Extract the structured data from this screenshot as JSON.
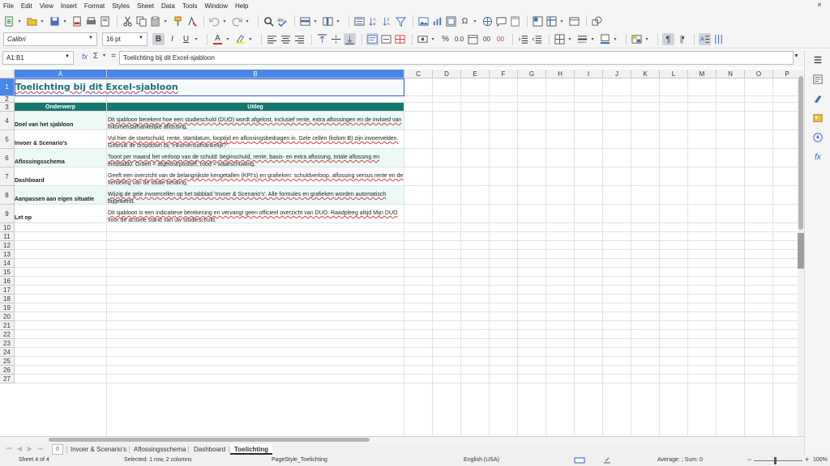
{
  "menubar": {
    "items": [
      "File",
      "Edit",
      "View",
      "Insert",
      "Format",
      "Styles",
      "Sheet",
      "Data",
      "Tools",
      "Window",
      "Help"
    ],
    "close_glyph": "×"
  },
  "toolbar": {
    "font_name": "Calibri",
    "font_size": "16 pt",
    "bold": "B",
    "italic": "I",
    "underline": "U",
    "font_color_letter": "A",
    "percent": "%",
    "decimal": "0.0",
    "remove_decimal": "00",
    "strike_decimal": "00",
    "currency_symbol": "$",
    "color_font": "#d32f2f",
    "color_highlight": "#ffeb3b",
    "color_border": "#1565c0"
  },
  "formulabar": {
    "name_box": "A1:B1",
    "content": "Toelichting bij dit Excel-sjabloon",
    "fx": "fx",
    "sigma": "Σ",
    "equals": "="
  },
  "grid": {
    "columns": [
      "A",
      "B",
      "C",
      "D",
      "E",
      "F",
      "G",
      "H",
      "I",
      "J",
      "K",
      "L",
      "M",
      "N",
      "O",
      "P"
    ],
    "rows": [
      "1",
      "2",
      "3",
      "4",
      "5",
      "6",
      "7",
      "8",
      "9",
      "10",
      "11",
      "12",
      "13",
      "14",
      "15",
      "16",
      "17",
      "18",
      "19",
      "20",
      "21",
      "22",
      "23",
      "24",
      "25",
      "26",
      "27"
    ],
    "title": "Toelichting bij dit Excel-sjabloon",
    "header_topic": "Onderwerp",
    "header_desc": "Uitleg",
    "header_color": "#17786f",
    "band_color": "#ebf9f7",
    "entries": [
      {
        "topic": "Doel van het sjabloon",
        "desc": "Dit sjabloon berekent hoe een studieschuld (DUO) wordt afgelost, inclusief rente, extra aflossingen en de invloed van inkomensafhankelijke aflossing."
      },
      {
        "topic": "Invoer & Scenario's",
        "desc": "Vul hier de startschuld, rente, startdatum, looptijd en aflossingsbedragen in. Gele cellen (kolom B) zijn invoervelden. Gebruik de dropdown bij 'Inkomensafhankelijk?'."
      },
      {
        "topic": "Aflossingsschema",
        "desc": "Toont per maand het verloop van de schuld: beginschuld, rente, basis- en extra aflossing, totale aflossing en eindsaldo. Groen = afgelost/positief, rood = waarschuwing."
      },
      {
        "topic": "Dashboard",
        "desc": "Geeft een overzicht van de belangrijkste kengetallen (KPI's) en grafieken: schuldverloop, aflossing versus rente en de verdeling van de totale betaling."
      },
      {
        "topic": "Aanpassen aan eigen situatie",
        "desc": "Wijzig de gele invoercellen op het tabblad 'Invoer & Scenario's'. Alle formules en grafieken worden automatisch bijgewerkt."
      },
      {
        "topic": "Let op",
        "desc": "Dit sjabloon is een indicatieve berekening en vervangt geen officieel overzicht van DUO. Raadpleeg altijd Mijn DUO voor de actuele stand van uw studieschuld."
      }
    ]
  },
  "tabs": {
    "add_label": "0",
    "sheets": [
      "Invoer & Scenario's",
      "Aflossingsschema",
      "Dashboard",
      "Toelichting"
    ],
    "active": "Toelichting"
  },
  "status": {
    "sheet": "Sheet 4 of 4",
    "selection": "Selected: 1 row, 2 columns",
    "page_style": "PageStyle_Toelichting",
    "language": "English (USA)",
    "sum": "Average: ; Sum: 0",
    "zoom": "100%"
  }
}
